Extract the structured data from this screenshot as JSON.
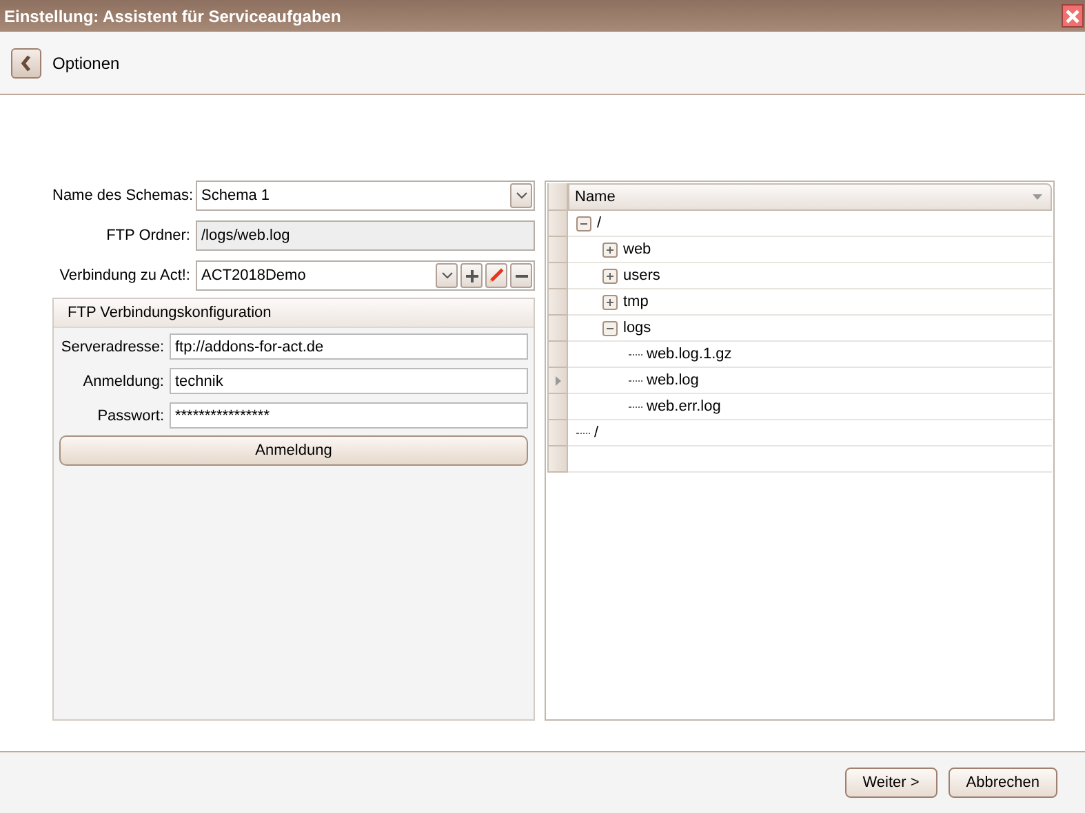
{
  "window": {
    "title": "Einstellung: Assistent für Serviceaufgaben"
  },
  "header": {
    "title": "Optionen"
  },
  "form": [
    {
      "kind": "dropdown",
      "label": "Name des Schemas:",
      "value": "Schema 1"
    },
    {
      "kind": "readonly",
      "label": "FTP Ordner:",
      "value": "/logs/web.log"
    },
    {
      "kind": "connection",
      "label": "Verbindung zu Act!:",
      "value": "ACT2018Demo"
    }
  ],
  "ftp_group": {
    "title": "FTP Verbindungskonfiguration",
    "fields": [
      {
        "label": "Serveradresse:",
        "value": "ftp://addons-for-act.de"
      },
      {
        "label": "Anmeldung:",
        "value": "technik"
      },
      {
        "label": "Passwort:",
        "value": "****************"
      }
    ],
    "button": "Anmeldung"
  },
  "tree": {
    "columns": [
      "Name"
    ],
    "nodes": [
      {
        "label": "/",
        "selected": false,
        "expanded": true,
        "children": [
          {
            "label": "web",
            "selected": false,
            "expanded": false
          },
          {
            "label": "users",
            "selected": false,
            "expanded": false
          },
          {
            "label": "tmp",
            "selected": false,
            "expanded": false
          },
          {
            "label": "logs",
            "selected": false,
            "expanded": true,
            "children": [
              {
                "label": "web.log.1.gz",
                "selected": false
              },
              {
                "label": "web.log",
                "selected": true
              },
              {
                "label": "web.err.log",
                "selected": false
              }
            ]
          }
        ]
      },
      {
        "label": "/",
        "selected": false
      }
    ]
  },
  "buttons": [
    "Weiter >",
    "Abbrechen"
  ]
}
